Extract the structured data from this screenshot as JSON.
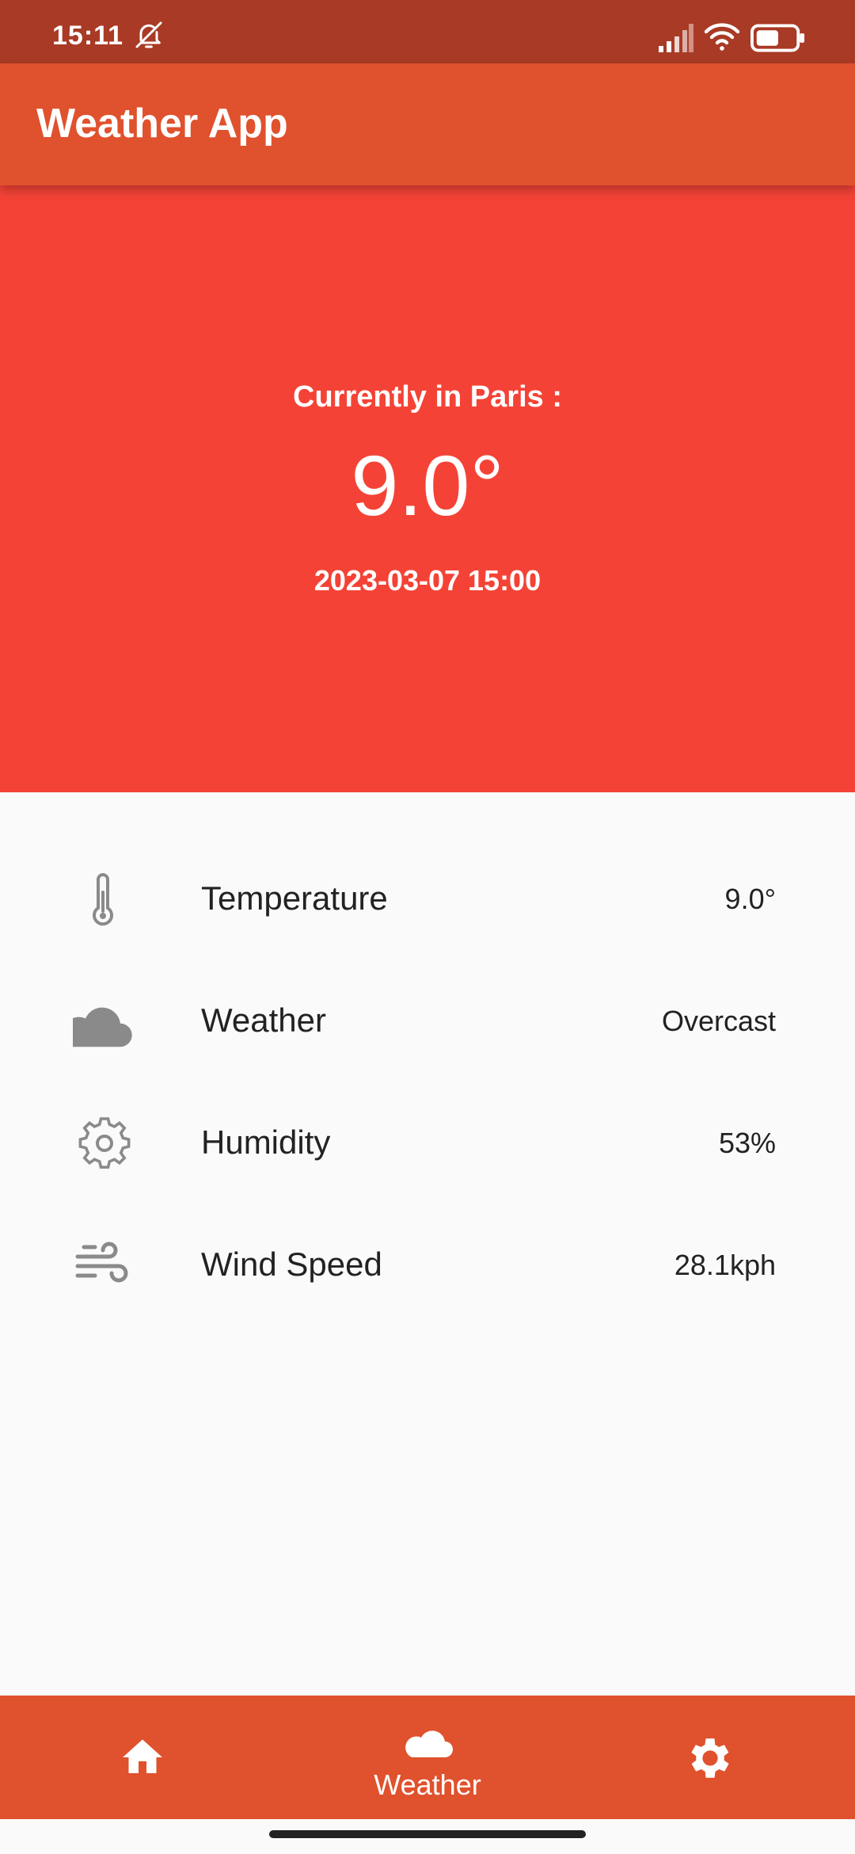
{
  "status_bar": {
    "time": "15:11"
  },
  "app_bar": {
    "title": "Weather App"
  },
  "hero": {
    "location_label": "Currently in Paris :",
    "temperature": "9.0°",
    "datetime": "2023-03-07 15:00"
  },
  "details": [
    {
      "icon": "thermometer-icon",
      "label": "Temperature",
      "value": "9.0°"
    },
    {
      "icon": "cloud-icon",
      "label": "Weather",
      "value": "Overcast"
    },
    {
      "icon": "gear-icon",
      "label": "Humidity",
      "value": "53%"
    },
    {
      "icon": "wind-icon",
      "label": "Wind Speed",
      "value": "28.1kph"
    }
  ],
  "bottom_nav": {
    "items": [
      {
        "icon": "home-icon",
        "label": ""
      },
      {
        "icon": "cloud-icon",
        "label": "Weather"
      },
      {
        "icon": "settings-icon",
        "label": ""
      }
    ]
  },
  "colors": {
    "status_bar": "#a93a25",
    "app_bar": "#e0512d",
    "hero": "#f44336",
    "background": "#fafafa",
    "icon_gray": "#8a8a8a"
  }
}
